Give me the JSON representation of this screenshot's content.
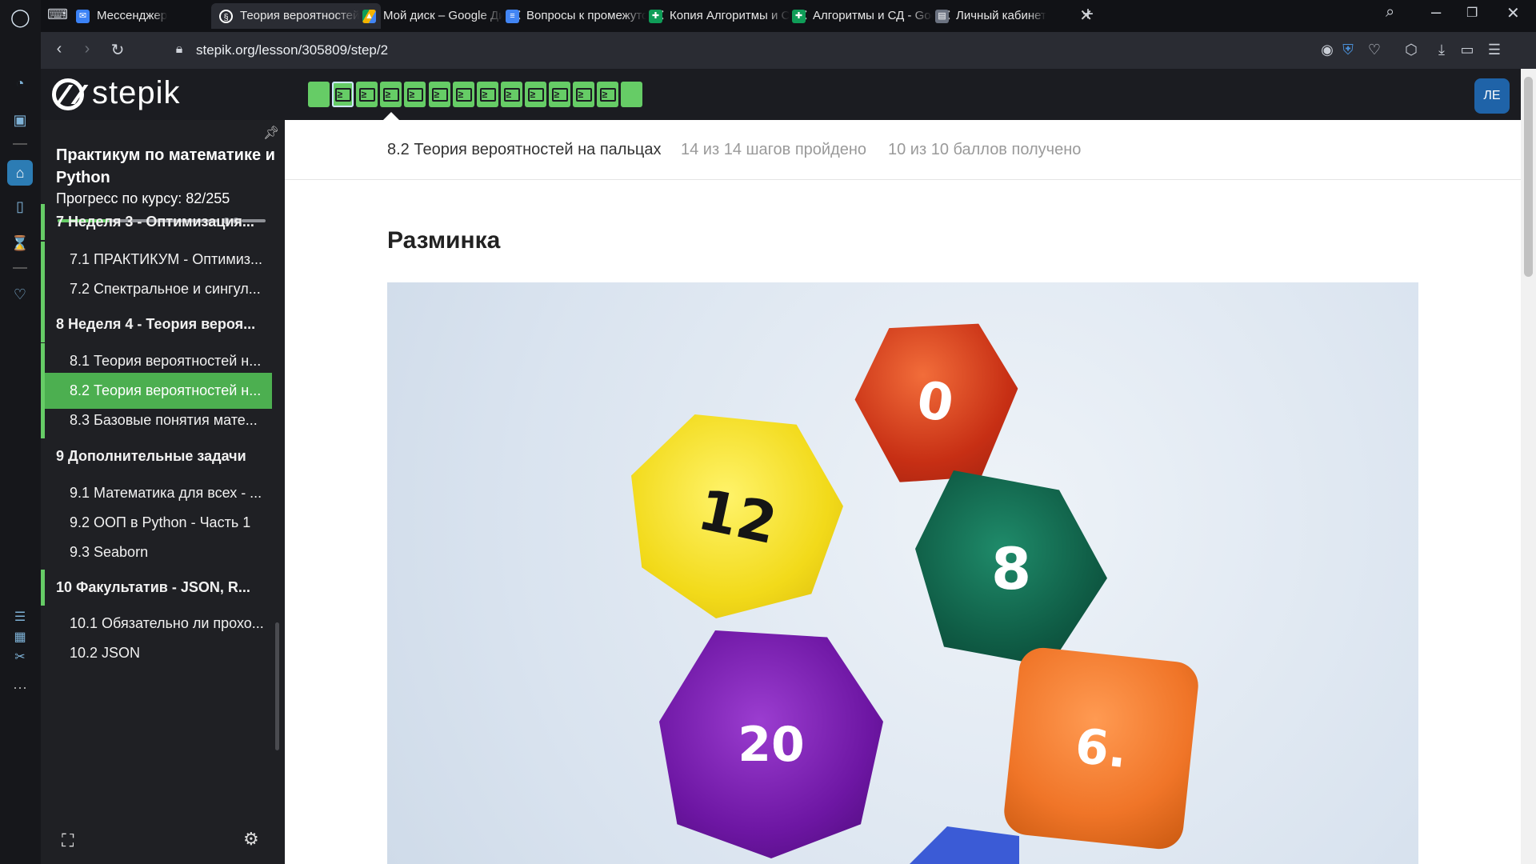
{
  "browser": {
    "tabs": [
      {
        "label": "Мессенджер",
        "favicon": "messenger-icon",
        "color": "#3b82f6"
      },
      {
        "label": "Теория вероятностей",
        "favicon": "stepik-icon",
        "color": "#2a2c33"
      },
      {
        "label": "Мой диск – Google Диск",
        "favicon": "google-drive-icon",
        "color": "#f4b400"
      },
      {
        "label": "Вопросы к промежуточной",
        "favicon": "google-docs-icon",
        "color": "#4285f4"
      },
      {
        "label": "Копия Алгоритмы и СД",
        "favicon": "google-sheets-icon",
        "color": "#0f9d58"
      },
      {
        "label": "Алгоритмы и СД - Google",
        "favicon": "google-sheets-icon",
        "color": "#0f9d58"
      },
      {
        "label": "Личный кабинет",
        "favicon": "page-icon",
        "color": "#6b7280"
      }
    ],
    "url": "stepik.org/lesson/305809/step/2"
  },
  "stepik": {
    "logo_text": "stepik",
    "avatar_initials": "ЛЕ",
    "steps": [
      {
        "kind": "text",
        "state": "passed"
      },
      {
        "kind": "code",
        "state": "passed",
        "current": true
      },
      {
        "kind": "code",
        "state": "passed"
      },
      {
        "kind": "code",
        "state": "passed"
      },
      {
        "kind": "code",
        "state": "passed"
      },
      {
        "kind": "code",
        "state": "passed"
      },
      {
        "kind": "code",
        "state": "passed"
      },
      {
        "kind": "code",
        "state": "passed"
      },
      {
        "kind": "code",
        "state": "passed"
      },
      {
        "kind": "code",
        "state": "passed"
      },
      {
        "kind": "code",
        "state": "passed"
      },
      {
        "kind": "code",
        "state": "passed"
      },
      {
        "kind": "code",
        "state": "passed"
      },
      {
        "kind": "text",
        "state": "passed"
      }
    ],
    "step_glyph": "≥"
  },
  "sidebar": {
    "course_title": "Практикум по математике и Python",
    "progress_label": "Прогресс по курсу:  82/255",
    "progress_fraction": 0.32,
    "items": [
      {
        "text": "7  Неделя 3 - Оптимизация...",
        "type": "sec"
      },
      {
        "text": "7.1  ПРАКТИКУМ - Оптимиз...",
        "type": "les"
      },
      {
        "text": "7.2  Спектральное и сингул...",
        "type": "les"
      },
      {
        "text": "8  Неделя 4 - Теория вероя...",
        "type": "sec"
      },
      {
        "text": "8.1  Теория вероятностей н...",
        "type": "les"
      },
      {
        "text": "8.2  Теория вероятностей н...",
        "type": "les"
      },
      {
        "text": "8.3  Базовые понятия мате...",
        "type": "les"
      },
      {
        "text": "9  Дополнительные задачи",
        "type": "sec"
      },
      {
        "text": "9.1  Математика для всех - ...",
        "type": "les"
      },
      {
        "text": "9.2  ООП в Python - Часть 1",
        "type": "les"
      },
      {
        "text": "9.3  Seaborn",
        "type": "les"
      },
      {
        "text": "10  Факультатив - JSON, R...",
        "type": "sec"
      },
      {
        "text": "10.1  Обязательно ли прохо...",
        "type": "les"
      },
      {
        "text": "10.2  JSON",
        "type": "les"
      }
    ]
  },
  "lesson": {
    "title": "8.2 Теория вероятностей на пальцах",
    "steps_passed": "14 из 14 шагов пройдено",
    "score": "10 из 10 баллов  получено",
    "step_heading": "Разминка"
  },
  "dice": [
    "12",
    "0",
    "8",
    "20",
    "6."
  ],
  "colors": {
    "accent_green": "#66cc66",
    "selected_green": "#4caf50",
    "avatar_blue": "#1f63a8"
  }
}
